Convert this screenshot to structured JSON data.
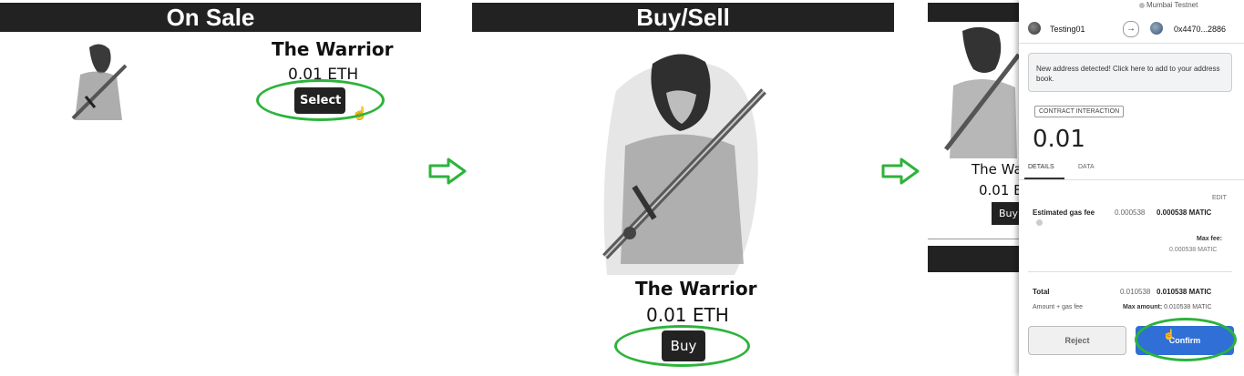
{
  "panel1": {
    "header": "On Sale",
    "item_title": "The Warrior",
    "price": "0.01 ETH",
    "button_label": "Select"
  },
  "panel2": {
    "header": "Buy/Sell",
    "item_title": "The Warrior",
    "price": "0.01 ETH",
    "button_label": "Buy"
  },
  "panel3_background": {
    "item_title": "The Wa",
    "price": "0.01 E",
    "button_label": "Buy"
  },
  "wallet": {
    "network": "Mumbai Testnet",
    "from_account": "Testing01",
    "to_address": "0x4470...2886",
    "notice": "New address detected! Click here to add to your address book.",
    "badge": "CONTRACT INTERACTION",
    "amount": "0.01",
    "tabs": [
      "DETAILS",
      "DATA"
    ],
    "edit_label": "EDIT",
    "gas_label": "Estimated gas fee",
    "gas_secondary": "0.000538",
    "gas_primary": "0.000538 MATIC",
    "max_fee_label": "Max fee:",
    "max_fee_value": "0.000538 MATIC",
    "total_label": "Total",
    "total_secondary": "0.010538",
    "total_primary": "0.010538 MATIC",
    "amount_gas_label": "Amount + gas fee",
    "max_amount_label": "Max amount:",
    "max_amount_value": "0.010538 MATIC",
    "reject_label": "Reject",
    "confirm_label": "Confirm"
  },
  "colors": {
    "header_bg": "#222222",
    "highlight": "#2db33b",
    "confirm": "#2f6fd6"
  }
}
